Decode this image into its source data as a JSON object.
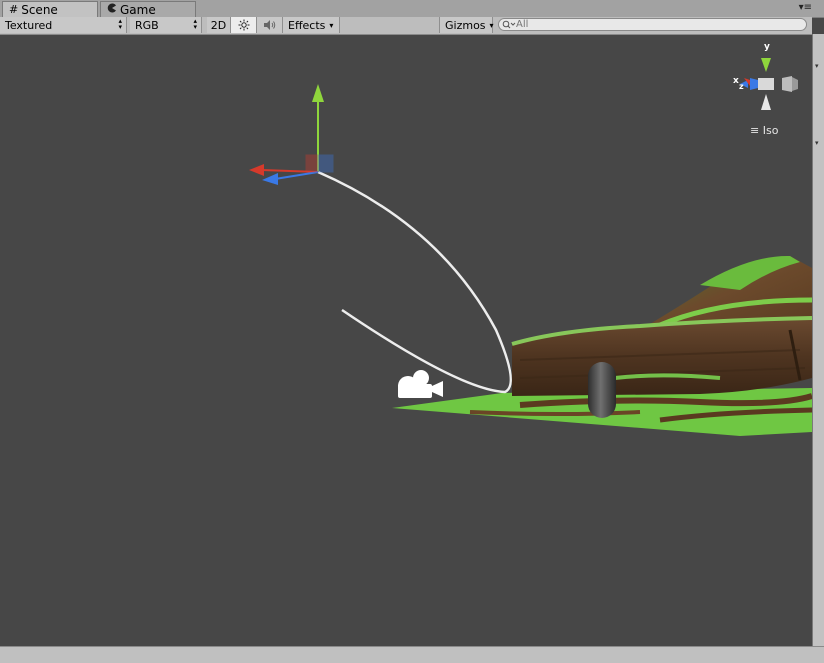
{
  "tabs": [
    {
      "label": "Scene",
      "icon": "grid-icon",
      "active": true
    },
    {
      "label": "Game",
      "icon": "pacman-icon",
      "active": false
    }
  ],
  "toolbar": {
    "shading_mode": "Textured",
    "render_mode": "RGB",
    "toggle_2d": "2D",
    "lighting_icon": "sun-icon",
    "audio_icon": "speaker-icon",
    "effects": "Effects",
    "gizmos": "Gizmos",
    "search_placeholder": "All"
  },
  "orientation_gizmo": {
    "y_label": "y",
    "x_label": "x",
    "z_label": "z",
    "projection": "Iso"
  },
  "colors": {
    "x_axis": "#d63a2b",
    "y_axis": "#8fd63c",
    "z_axis": "#3a79e6",
    "ground": "#6fc743",
    "viewport_bg": "#474747"
  }
}
